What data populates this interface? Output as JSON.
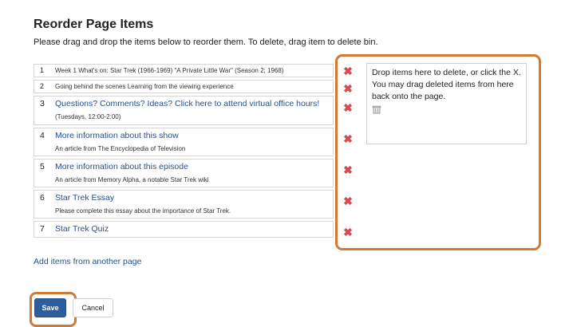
{
  "page": {
    "title": "Reorder Page Items",
    "instructions": "Please drag and drop the items below to reorder them. To delete, drag item to delete bin."
  },
  "items": [
    {
      "num": "1",
      "text": "Week 1 What's on: Star Trek (1966-1969) \"A Private Little War\" (Season 2; 1968)"
    },
    {
      "num": "2",
      "text": "Going behind the scenes Learning from the viewing experience"
    },
    {
      "num": "3",
      "title": "Questions? Comments? Ideas? Click here to attend virtual office hours!",
      "subtitle": "(Tuesdays, 12:00-2:00)"
    },
    {
      "num": "4",
      "title": "More information about this show",
      "subtitle": "An article from The Encyclopedia of Television"
    },
    {
      "num": "5",
      "title": "More information about this episode",
      "subtitle": "An article from Memory Alpha, a notable Star Trek wiki"
    },
    {
      "num": "6",
      "title": "Star Trek Essay",
      "subtitle": "Please complete this essay about the importance of Star Trek."
    },
    {
      "num": "7",
      "title": "Star Trek Quiz"
    }
  ],
  "delete_icon": "close-icon",
  "delete_color": "#d94a4a",
  "bin": {
    "text": "Drop items here to delete, or click the X. You may drag deleted items from here back onto the page.",
    "icon": "trash-icon"
  },
  "add_link": "Add items from another page",
  "buttons": {
    "save": "Save",
    "cancel": "Cancel"
  },
  "colors": {
    "accent": "#2c5e9e",
    "highlight": "#d07a35",
    "link": "#2a4f8a"
  }
}
